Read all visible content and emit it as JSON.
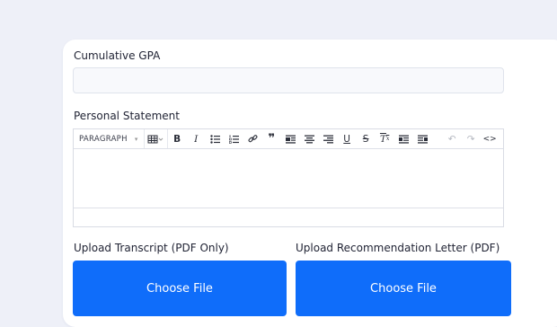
{
  "form": {
    "gpa_label": "Cumulative GPA",
    "gpa_value": "",
    "statement_label": "Personal Statement",
    "transcript_label": "Upload Transcript (PDF Only)",
    "recommendation_label": "Upload Recommendation Letter (PDF)",
    "transcript_button": "Choose File",
    "recommendation_button": "Choose File"
  },
  "editor": {
    "format_select": "PARAGRAPH",
    "toolbar_icons": [
      "table-icon",
      "bold-icon",
      "italic-icon",
      "bullet-list-icon",
      "numbered-list-icon",
      "link-icon",
      "blockquote-icon",
      "align-left-icon",
      "align-center-icon",
      "align-right-icon",
      "underline-icon",
      "strikethrough-icon",
      "clear-format-icon",
      "indent-icon",
      "outdent-icon",
      "undo-icon",
      "redo-icon",
      "source-code-icon"
    ]
  },
  "colors": {
    "primary": "#0f6dfa",
    "page_bg": "#eef0f8",
    "card_bg": "#ffffff"
  }
}
